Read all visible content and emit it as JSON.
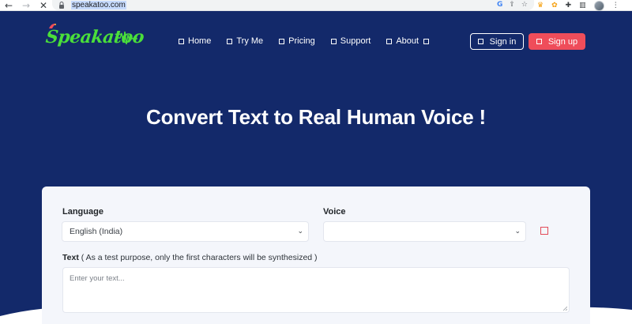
{
  "browser": {
    "url": "speakatoo.com",
    "back_icon": "arrow-left-icon",
    "forward_icon": "arrow-right-icon",
    "stop_icon": "close-icon"
  },
  "header": {
    "logo_text": "Speakatoo",
    "nav": [
      {
        "label": "Home"
      },
      {
        "label": "Try Me"
      },
      {
        "label": "Pricing"
      },
      {
        "label": "Support"
      },
      {
        "label": "About"
      }
    ],
    "signin_label": "Sign in",
    "signup_label": "Sign up"
  },
  "hero": {
    "title": "Convert Text to Real Human Voice !"
  },
  "form": {
    "language_label": "Language",
    "language_value": "English (India)",
    "voice_label": "Voice",
    "voice_value": "",
    "text_label": "Text",
    "text_note": "( As a test purpose, only the first characters will be synthesized )",
    "text_placeholder": "Enter your text..."
  },
  "colors": {
    "background": "#13296a",
    "accent": "#ef4d5a",
    "logo": "#4ade3a",
    "card": "#f4f6fb"
  }
}
